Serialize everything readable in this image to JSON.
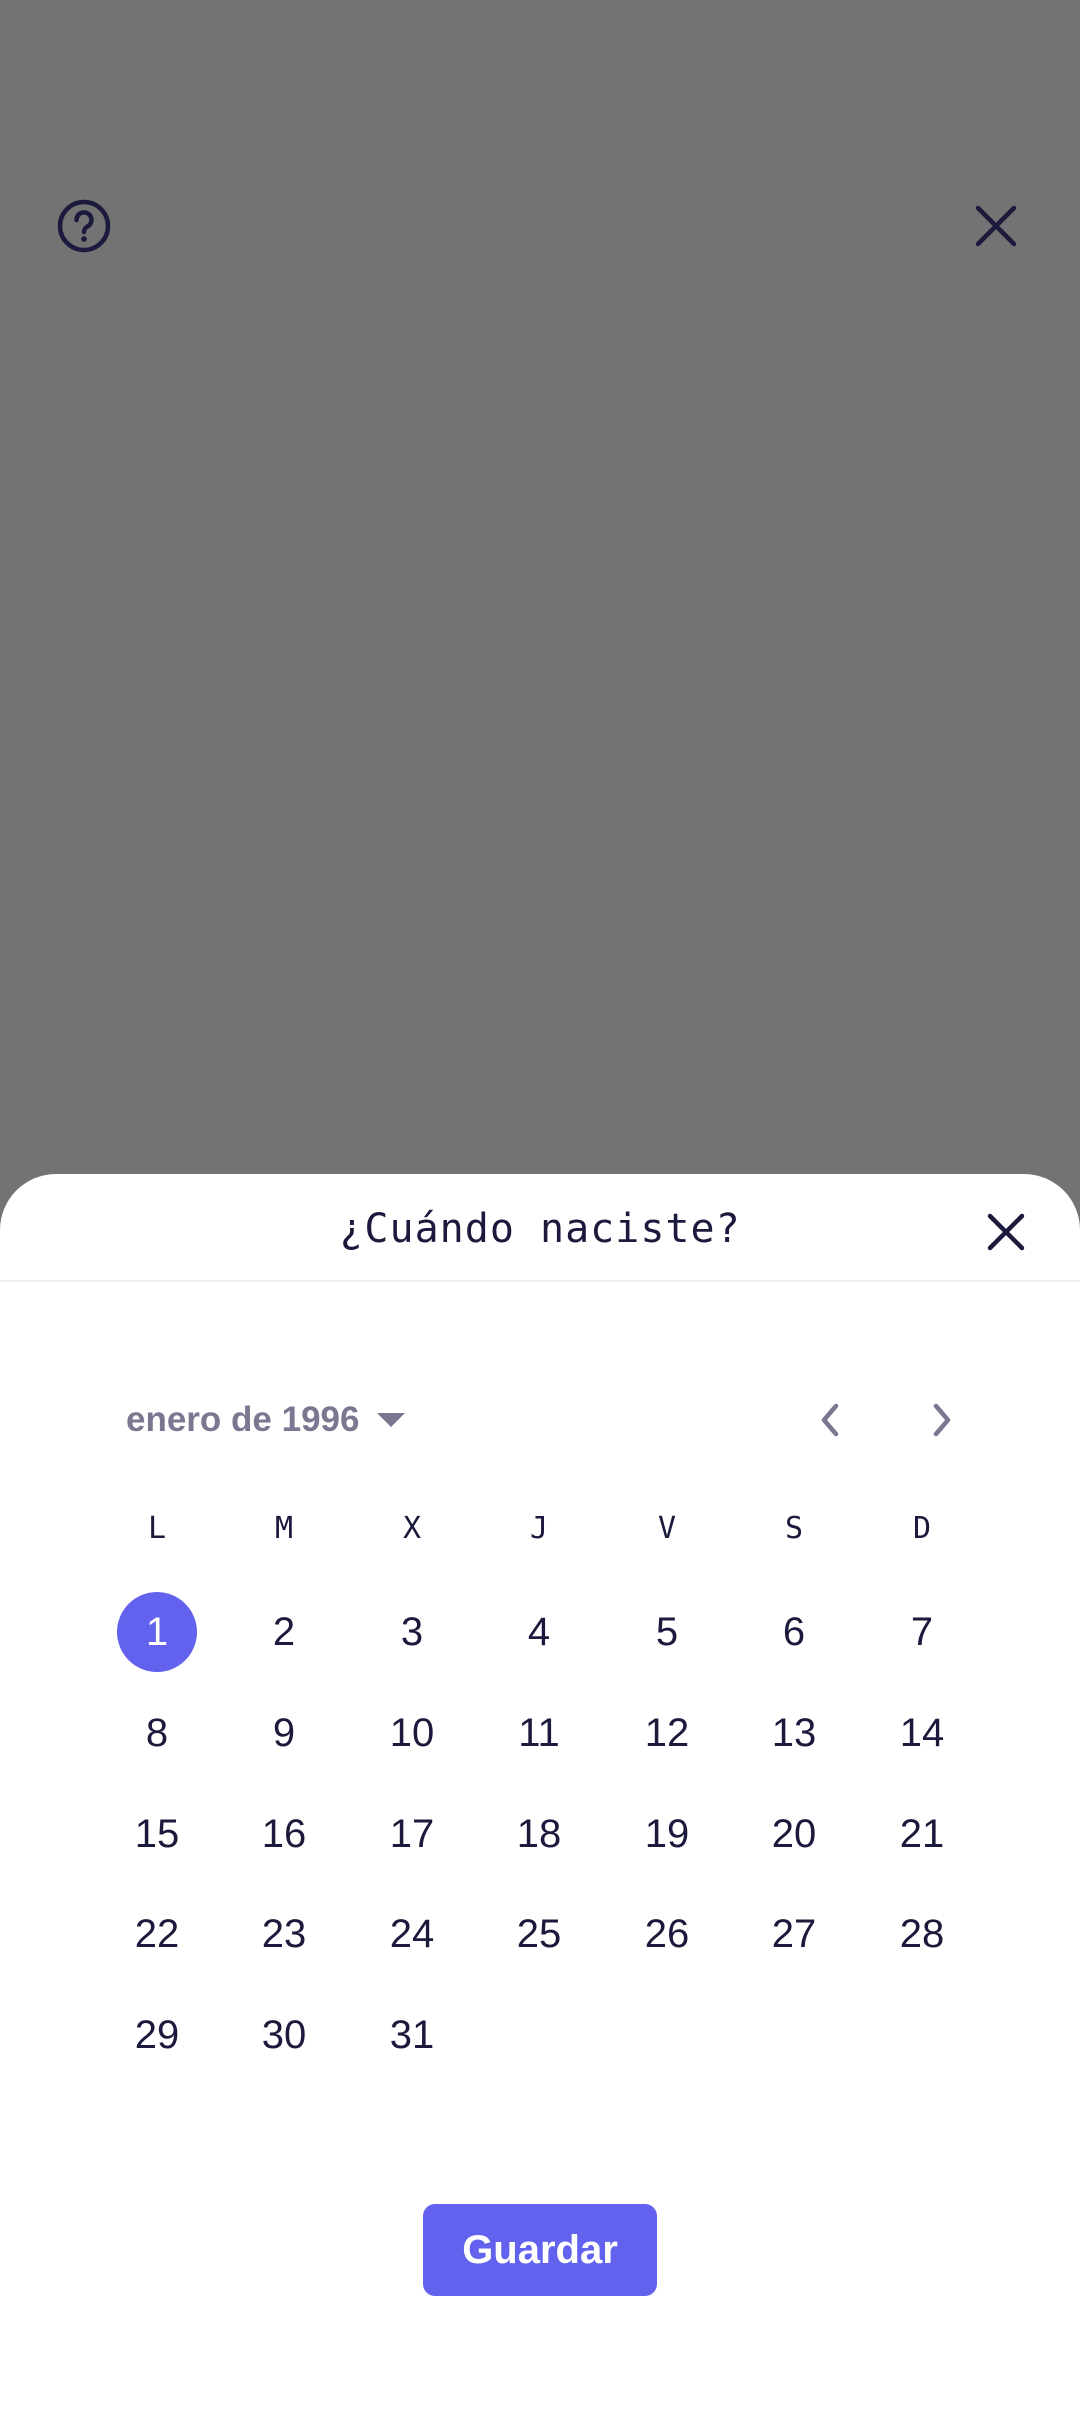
{
  "background": {
    "help_icon": "help-circle-icon",
    "close_icon": "close-icon"
  },
  "sheet": {
    "title": "¿Cuándo naciste?",
    "close_icon": "close-icon"
  },
  "calendar": {
    "month_label": "enero de 1996",
    "dropdown_icon": "caret-down-icon",
    "prev_icon": "chevron-left-icon",
    "next_icon": "chevron-right-icon",
    "weekdays": [
      "L",
      "M",
      "X",
      "J",
      "V",
      "S",
      "D"
    ],
    "days": [
      "1",
      "2",
      "3",
      "4",
      "5",
      "6",
      "7",
      "8",
      "9",
      "10",
      "11",
      "12",
      "13",
      "14",
      "15",
      "16",
      "17",
      "18",
      "19",
      "20",
      "21",
      "22",
      "23",
      "24",
      "25",
      "26",
      "27",
      "28",
      "29",
      "30",
      "31"
    ],
    "selected_day": "1"
  },
  "save_button": {
    "label": "Guardar"
  },
  "colors": {
    "accent": "#6262ee",
    "overlay": "#737373",
    "text_dark": "#1b1a3c",
    "text_muted": "#7a7891"
  }
}
